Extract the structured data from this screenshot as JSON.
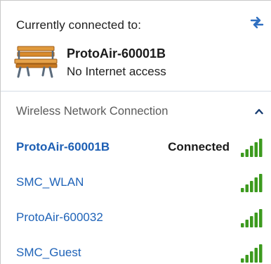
{
  "current": {
    "title": "Currently connected to:",
    "network_name": "ProtoAir-60001B",
    "network_status": "No Internet access",
    "icons": {
      "refresh": "refresh-icon",
      "network": "park-bench-icon"
    }
  },
  "section": {
    "label": "Wireless Network Connection",
    "toggle_icon": "chevron-up-icon"
  },
  "networks": [
    {
      "name": "ProtoAir-60001B",
      "state": "Connected",
      "active": true,
      "signal_bars": 5
    },
    {
      "name": "SMC_WLAN",
      "state": "",
      "active": false,
      "signal_bars": 5
    },
    {
      "name": "ProtoAir-600032",
      "state": "",
      "active": false,
      "signal_bars": 5
    },
    {
      "name": "SMC_Guest",
      "state": "",
      "active": false,
      "signal_bars": 5
    }
  ],
  "colors": {
    "link": "#1f63b8",
    "signal": "#3c9a1e",
    "bench_wood": "#d98a2b"
  }
}
